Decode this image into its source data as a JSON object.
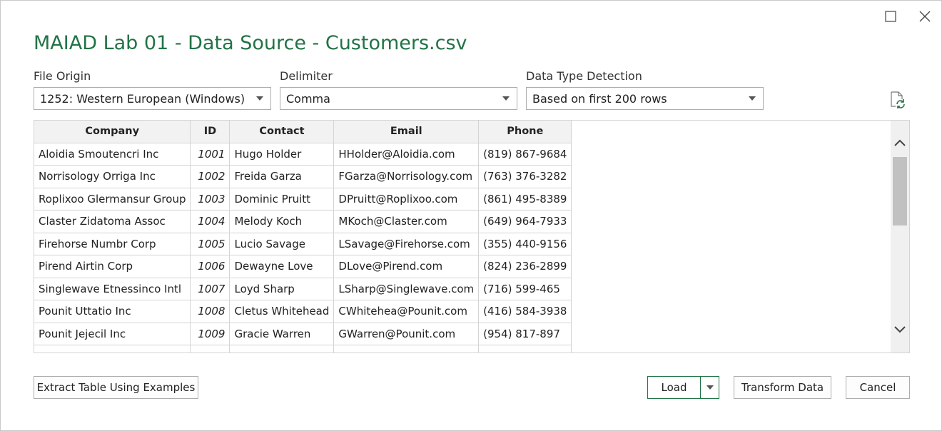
{
  "window": {
    "title": "MAIAD Lab 01 - Data Source - Customers.csv"
  },
  "options": {
    "file_origin": {
      "label": "File Origin",
      "value": "1252: Western European (Windows)"
    },
    "delimiter": {
      "label": "Delimiter",
      "value": "Comma"
    },
    "data_type_detection": {
      "label": "Data Type Detection",
      "value": "Based on first 200 rows"
    }
  },
  "preview": {
    "columns": [
      "Company",
      "ID",
      "Contact",
      "Email",
      "Phone"
    ],
    "rows": [
      [
        "Aloidia Smoutencri Inc",
        "1001",
        "Hugo Holder",
        "HHolder@Aloidia.com",
        "(819) 867-9684"
      ],
      [
        "Norrisology Orriga Inc",
        "1002",
        "Freida Garza",
        "FGarza@Norrisology.com",
        "(763) 376-3282"
      ],
      [
        "Roplixoo Glermansur Group",
        "1003",
        "Dominic Pruitt",
        "DPruitt@Roplixoo.com",
        "(861) 495-8389"
      ],
      [
        "Claster Zidatoma Assoc",
        "1004",
        "Melody Koch",
        "MKoch@Claster.com",
        "(649) 964-7933"
      ],
      [
        "Firehorse Numbr Corp",
        "1005",
        "Lucio Savage",
        "LSavage@Firehorse.com",
        "(355) 440-9156"
      ],
      [
        "Pirend Airtin Corp",
        "1006",
        "Dewayne Love",
        "DLove@Pirend.com",
        "(824) 236-2899"
      ],
      [
        "Singlewave Etnessinco Intl",
        "1007",
        "Loyd Sharp",
        "LSharp@Singlewave.com",
        "(716) 599-465"
      ],
      [
        "Pounit Uttatio Inc",
        "1008",
        "Cletus Whitehead",
        "CWhitehea@Pounit.com",
        "(416) 584-3938"
      ],
      [
        "Pounit Jejecil Inc",
        "1009",
        "Gracie Warren",
        "GWarren@Pounit.com",
        "(954) 817-897"
      ]
    ]
  },
  "buttons": {
    "extract": "Extract Table Using Examples",
    "load": "Load",
    "transform": "Transform Data",
    "cancel": "Cancel"
  },
  "icons": {
    "maximize": "maximize-icon",
    "close": "close-icon",
    "refresh": "refresh-icon",
    "dropdown": "chevron-down-icon"
  },
  "colors": {
    "accent": "#217346"
  }
}
